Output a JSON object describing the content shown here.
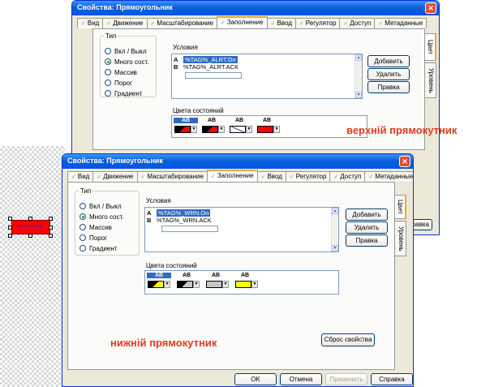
{
  "dialog_top": {
    "title": "Свойства: Прямоугольник",
    "tabs": [
      "Вид",
      "Движение",
      "Масштабирование",
      "Заполнение",
      "Ввод",
      "Регулятор",
      "Доступ",
      "Метаданные"
    ],
    "active_tab": "Заполнение",
    "type_group": {
      "label": "Тип",
      "options": [
        "Вкл / Выкл",
        "Много сост.",
        "Массив",
        "Порог",
        "Градиент"
      ],
      "selected": "Много сост."
    },
    "conditions": {
      "label": "Условия",
      "rows": [
        {
          "letter": "A",
          "expr": "%TAG%_ALRT.On"
        },
        {
          "letter": "B",
          "expr": "%TAG%_ALRT.ACK"
        }
      ]
    },
    "buttons": {
      "add": "Добавить",
      "delete": "Удалить",
      "edit": "Правка"
    },
    "state_colors": {
      "label": "Цвета состояний",
      "items": [
        {
          "label": "AB",
          "color": "#ff0000"
        },
        {
          "label": "AB",
          "color": "#ff0000"
        },
        {
          "label": "AB",
          "color": "#ffffff"
        },
        {
          "label": "AB",
          "color": "#ff0000"
        }
      ]
    },
    "side_tabs": [
      "Цвет",
      "Уровень"
    ],
    "annotation": "верхній прямокутник"
  },
  "dialog_bottom": {
    "title": "Свойства: Прямоугольник",
    "tabs": [
      "Вид",
      "Движение",
      "Масштабирование",
      "Заполнение",
      "Ввод",
      "Регулятор",
      "Доступ",
      "Метаданные"
    ],
    "active_tab": "Заполнение",
    "type_group": {
      "label": "Тип",
      "options": [
        "Вкл / Выкл",
        "Много сост.",
        "Массив",
        "Порог",
        "Градиент"
      ],
      "selected": "Много сост."
    },
    "conditions": {
      "label": "Условия",
      "rows": [
        {
          "letter": "A",
          "expr": "%TAG%_WRN.On"
        },
        {
          "letter": "B",
          "expr": "%TAG%_WRN.ACK"
        }
      ]
    },
    "buttons": {
      "add": "Добавить",
      "delete": "Удалить",
      "edit": "Правка",
      "reset": "Сброс свойства"
    },
    "state_colors": {
      "label": "Цвета состояний",
      "items": [
        {
          "label": "AB",
          "color": "#ffff00"
        },
        {
          "label": "AB",
          "color": "#c8c8c8"
        },
        {
          "label": "AB",
          "color": "#c8c8c8"
        },
        {
          "label": "AB",
          "color": "#ffff00"
        }
      ]
    },
    "side_tabs": [
      "Цвет",
      "Уровень"
    ],
    "annotation": "нижній прямокутник",
    "footer": {
      "ok": "OK",
      "cancel": "Отмена",
      "apply": "Применить",
      "help": "Справка"
    }
  },
  "behind_fragment": {
    "button_text": "равка"
  }
}
